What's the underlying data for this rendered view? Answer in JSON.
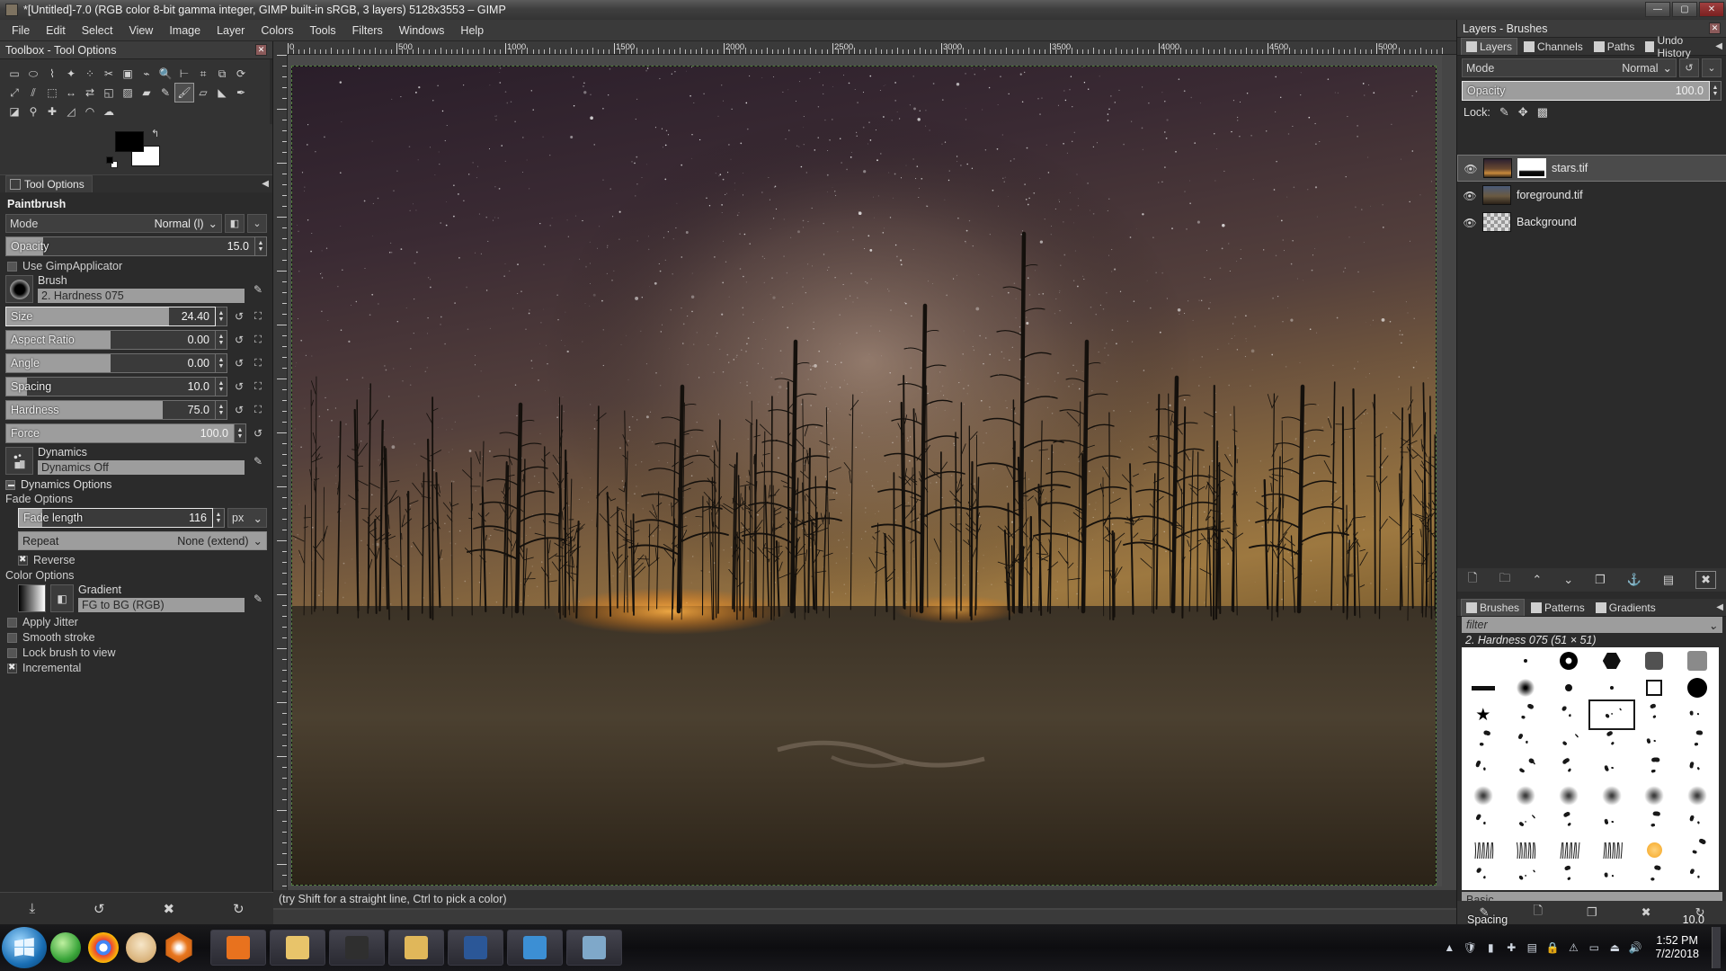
{
  "window": {
    "title": "*[Untitled]-7.0 (RGB color 8-bit gamma integer, GIMP built-in sRGB, 3 layers) 5128x3553 – GIMP",
    "min_label": "—",
    "max_label": "▢",
    "close_label": "✕"
  },
  "menubar": {
    "items": [
      "File",
      "Edit",
      "Select",
      "View",
      "Image",
      "Layer",
      "Colors",
      "Tools",
      "Filters",
      "Windows",
      "Help"
    ]
  },
  "toolbox": {
    "dock_title": "Toolbox - Tool Options",
    "close_label": "✕",
    "tools": [
      {
        "name": "rect-select-tool",
        "glyph": "▭"
      },
      {
        "name": "ellipse-select-tool",
        "glyph": "⬭"
      },
      {
        "name": "free-select-tool",
        "glyph": "⌇"
      },
      {
        "name": "fuzzy-select-tool",
        "glyph": "✦"
      },
      {
        "name": "select-by-color-tool",
        "glyph": "⁘"
      },
      {
        "name": "scissors-select-tool",
        "glyph": "✂"
      },
      {
        "name": "foreground-select-tool",
        "glyph": "▣"
      },
      {
        "name": "paths-tool",
        "glyph": "⌁"
      },
      {
        "name": "zoom-tool",
        "glyph": "🔍"
      },
      {
        "name": "measure-tool",
        "glyph": "⊢"
      },
      {
        "name": "crop-tool",
        "glyph": "⌗"
      },
      {
        "name": "transform-tool",
        "glyph": "⧉"
      },
      {
        "name": "rotate-tool",
        "glyph": "⟳"
      },
      {
        "name": "scale-tool",
        "glyph": "⤢"
      },
      {
        "name": "shear-tool",
        "glyph": "⫽"
      },
      {
        "name": "perspective-tool",
        "glyph": "⬚"
      },
      {
        "name": "handle-transform-tool",
        "glyph": "↔"
      },
      {
        "name": "flip-tool",
        "glyph": "⇄"
      },
      {
        "name": "cage-transform-tool",
        "glyph": "◱"
      },
      {
        "name": "bucket-fill-tool",
        "glyph": "▨"
      },
      {
        "name": "gradient-tool",
        "glyph": "▰"
      },
      {
        "name": "pencil-tool",
        "glyph": "✎"
      },
      {
        "name": "paintbrush-tool",
        "glyph": "🖌"
      },
      {
        "name": "eraser-tool",
        "glyph": "▱"
      },
      {
        "name": "airbrush-tool",
        "glyph": "◣"
      },
      {
        "name": "ink-tool",
        "glyph": "✒"
      },
      {
        "name": "mypaint-brush-tool",
        "glyph": "◪"
      },
      {
        "name": "clone-tool",
        "glyph": "⚲"
      },
      {
        "name": "heal-tool",
        "glyph": "✚"
      },
      {
        "name": "perspective-clone-tool",
        "glyph": "◿"
      },
      {
        "name": "blur-sharpen-tool",
        "glyph": "◠"
      },
      {
        "name": "smudge-tool",
        "glyph": "☁"
      }
    ],
    "selected_tool_index": 22,
    "fg_color": "#000000",
    "bg_color": "#ffffff",
    "swap_icon": "↰",
    "tab_label": "Tool Options"
  },
  "tool_options": {
    "heading": "Paintbrush",
    "mode": {
      "label": "Mode",
      "value": "Normal (l)"
    },
    "opacity": {
      "label": "Opacity",
      "value": "15.0",
      "fill_pct": 15
    },
    "use_gimp_applicator": {
      "label": "Use GimpApplicator",
      "checked": false
    },
    "brush": {
      "caption": "Brush",
      "value": "2. Hardness 075"
    },
    "size": {
      "label": "Size",
      "value": "24.40",
      "fill_pct": 78
    },
    "aspect_ratio": {
      "label": "Aspect Ratio",
      "value": "0.00",
      "fill_pct": 50
    },
    "angle": {
      "label": "Angle",
      "value": "0.00",
      "fill_pct": 50
    },
    "spacing": {
      "label": "Spacing",
      "value": "10.0",
      "fill_pct": 10
    },
    "hardness": {
      "label": "Hardness",
      "value": "75.0",
      "fill_pct": 75
    },
    "force": {
      "label": "Force",
      "value": "100.0",
      "fill_pct": 100
    },
    "dynamics": {
      "caption": "Dynamics",
      "value": "Dynamics Off"
    },
    "dynamics_options": {
      "label": "Dynamics Options"
    },
    "fade_options": {
      "label": "Fade Options"
    },
    "fade_length": {
      "label": "Fade length",
      "value": "116",
      "unit": "px",
      "fill_pct": 12
    },
    "repeat": {
      "label": "Repeat",
      "value": "None (extend)"
    },
    "reverse": {
      "label": "Reverse",
      "checked": true
    },
    "color_options": {
      "label": "Color Options"
    },
    "gradient": {
      "caption": "Gradient",
      "value": "FG to BG (RGB)"
    },
    "apply_jitter": {
      "label": "Apply Jitter",
      "checked": false
    },
    "smooth_stroke": {
      "label": "Smooth stroke",
      "checked": false
    },
    "lock_brush_to_view": {
      "label": "Lock brush to view",
      "checked": false
    },
    "incremental": {
      "label": "Incremental",
      "checked": true
    },
    "bottom_buttons": [
      {
        "name": "save-tool-preset-button",
        "glyph": "⤓"
      },
      {
        "name": "restore-tool-preset-button",
        "glyph": "↺"
      },
      {
        "name": "delete-tool-preset-button",
        "glyph": "✖"
      },
      {
        "name": "reset-tool-options-button",
        "glyph": "↻"
      }
    ]
  },
  "canvas": {
    "ruler_labels": [
      "0",
      "500",
      "1000",
      "1500",
      "2000",
      "2500",
      "3000",
      "3500",
      "4000",
      "4500",
      "5000"
    ],
    "status_text": "(try Shift for a straight line, Ctrl to pick a color)"
  },
  "right_dock": {
    "title": "Layers - Brushes",
    "close_label": "✕",
    "tabs": [
      {
        "label": "Layers",
        "icon": "layers-icon",
        "active": true
      },
      {
        "label": "Channels",
        "icon": "channels-icon",
        "active": false
      },
      {
        "label": "Paths",
        "icon": "paths-icon",
        "active": false
      },
      {
        "label": "Undo History",
        "icon": "undo-history-icon",
        "active": false
      }
    ],
    "menu_glyph": "◀",
    "mode": {
      "label": "Mode",
      "value": "Normal"
    },
    "opacity": {
      "label": "Opacity",
      "value": "100.0",
      "fill_pct": 100
    },
    "lock": {
      "label": "Lock:",
      "items": [
        {
          "name": "lock-pixels-icon",
          "glyph": "✎"
        },
        {
          "name": "lock-position-icon",
          "glyph": "✥"
        },
        {
          "name": "lock-alpha-icon",
          "glyph": "▦"
        }
      ]
    },
    "layers": [
      {
        "name": "stars.tif",
        "visible": true,
        "selected": true,
        "has_mask": true,
        "thumb": "sky"
      },
      {
        "name": "foreground.tif",
        "visible": true,
        "selected": false,
        "has_mask": false,
        "thumb": "fg"
      },
      {
        "name": "Background",
        "visible": true,
        "selected": false,
        "has_mask": false,
        "thumb": "checker"
      }
    ],
    "layer_buttons": [
      {
        "name": "new-layer-button",
        "glyph": "🗋"
      },
      {
        "name": "new-layer-group-button",
        "glyph": "🗀"
      },
      {
        "name": "raise-layer-button",
        "glyph": "⌃"
      },
      {
        "name": "lower-layer-button",
        "glyph": "⌄"
      },
      {
        "name": "duplicate-layer-button",
        "glyph": "❐"
      },
      {
        "name": "anchor-layer-button",
        "glyph": "⚓"
      },
      {
        "name": "merge-layer-button",
        "glyph": "▤"
      },
      {
        "name": "delete-layer-button",
        "glyph": "✖"
      }
    ],
    "brush_tabs": [
      {
        "label": "Brushes",
        "icon": "brushes-icon",
        "active": true
      },
      {
        "label": "Patterns",
        "icon": "patterns-icon",
        "active": false
      },
      {
        "label": "Gradients",
        "icon": "gradients-icon",
        "active": false
      }
    ],
    "brush_menu_glyph": "◀",
    "filter_placeholder": "filter",
    "filter_value": "",
    "selected_brush_label": "2. Hardness 075 (51 × 51)",
    "brush_tag_selector": "Basic,",
    "brush_spacing": {
      "label": "Spacing",
      "value": "10.0",
      "fill_pct": 10
    },
    "brush_buttons": [
      {
        "name": "edit-brush-button",
        "glyph": "✎"
      },
      {
        "name": "new-brush-button",
        "glyph": "🗋"
      },
      {
        "name": "duplicate-brush-button",
        "glyph": "❐"
      },
      {
        "name": "delete-brush-button",
        "glyph": "✖"
      },
      {
        "name": "refresh-brushes-button",
        "glyph": "↻"
      }
    ],
    "selected_brush_index": 15
  },
  "taskbar": {
    "start_label": "Start",
    "quick_launch": [
      {
        "name": "quicklaunch-windows-icon"
      },
      {
        "name": "quicklaunch-chrome-icon"
      },
      {
        "name": "quicklaunch-app-icon"
      },
      {
        "name": "quicklaunch-orange-icon"
      }
    ],
    "buttons": [
      {
        "name": "taskbar-button-firefox"
      },
      {
        "name": "taskbar-button-explorer"
      },
      {
        "name": "taskbar-button-terminal"
      },
      {
        "name": "taskbar-button-folder"
      },
      {
        "name": "taskbar-button-word"
      },
      {
        "name": "taskbar-button-app"
      },
      {
        "name": "taskbar-button-gimp"
      }
    ],
    "tray": [
      {
        "name": "tray-arrow-icon",
        "glyph": "▲"
      },
      {
        "name": "tray-shield-icon",
        "glyph": "🛡"
      },
      {
        "name": "tray-network-icon",
        "glyph": "▮"
      },
      {
        "name": "tray-bluetooth-icon",
        "glyph": "✚"
      },
      {
        "name": "tray-folder-icon",
        "glyph": "▤"
      },
      {
        "name": "tray-lock-icon",
        "glyph": "🔒"
      },
      {
        "name": "tray-warning-icon",
        "glyph": "⚠"
      },
      {
        "name": "tray-disk-icon",
        "glyph": "▭"
      },
      {
        "name": "tray-eject-icon",
        "glyph": "⏏"
      },
      {
        "name": "tray-volume-icon",
        "glyph": "🔊"
      }
    ],
    "clock_time": "1:52 PM",
    "clock_date": "7/2/2018"
  }
}
